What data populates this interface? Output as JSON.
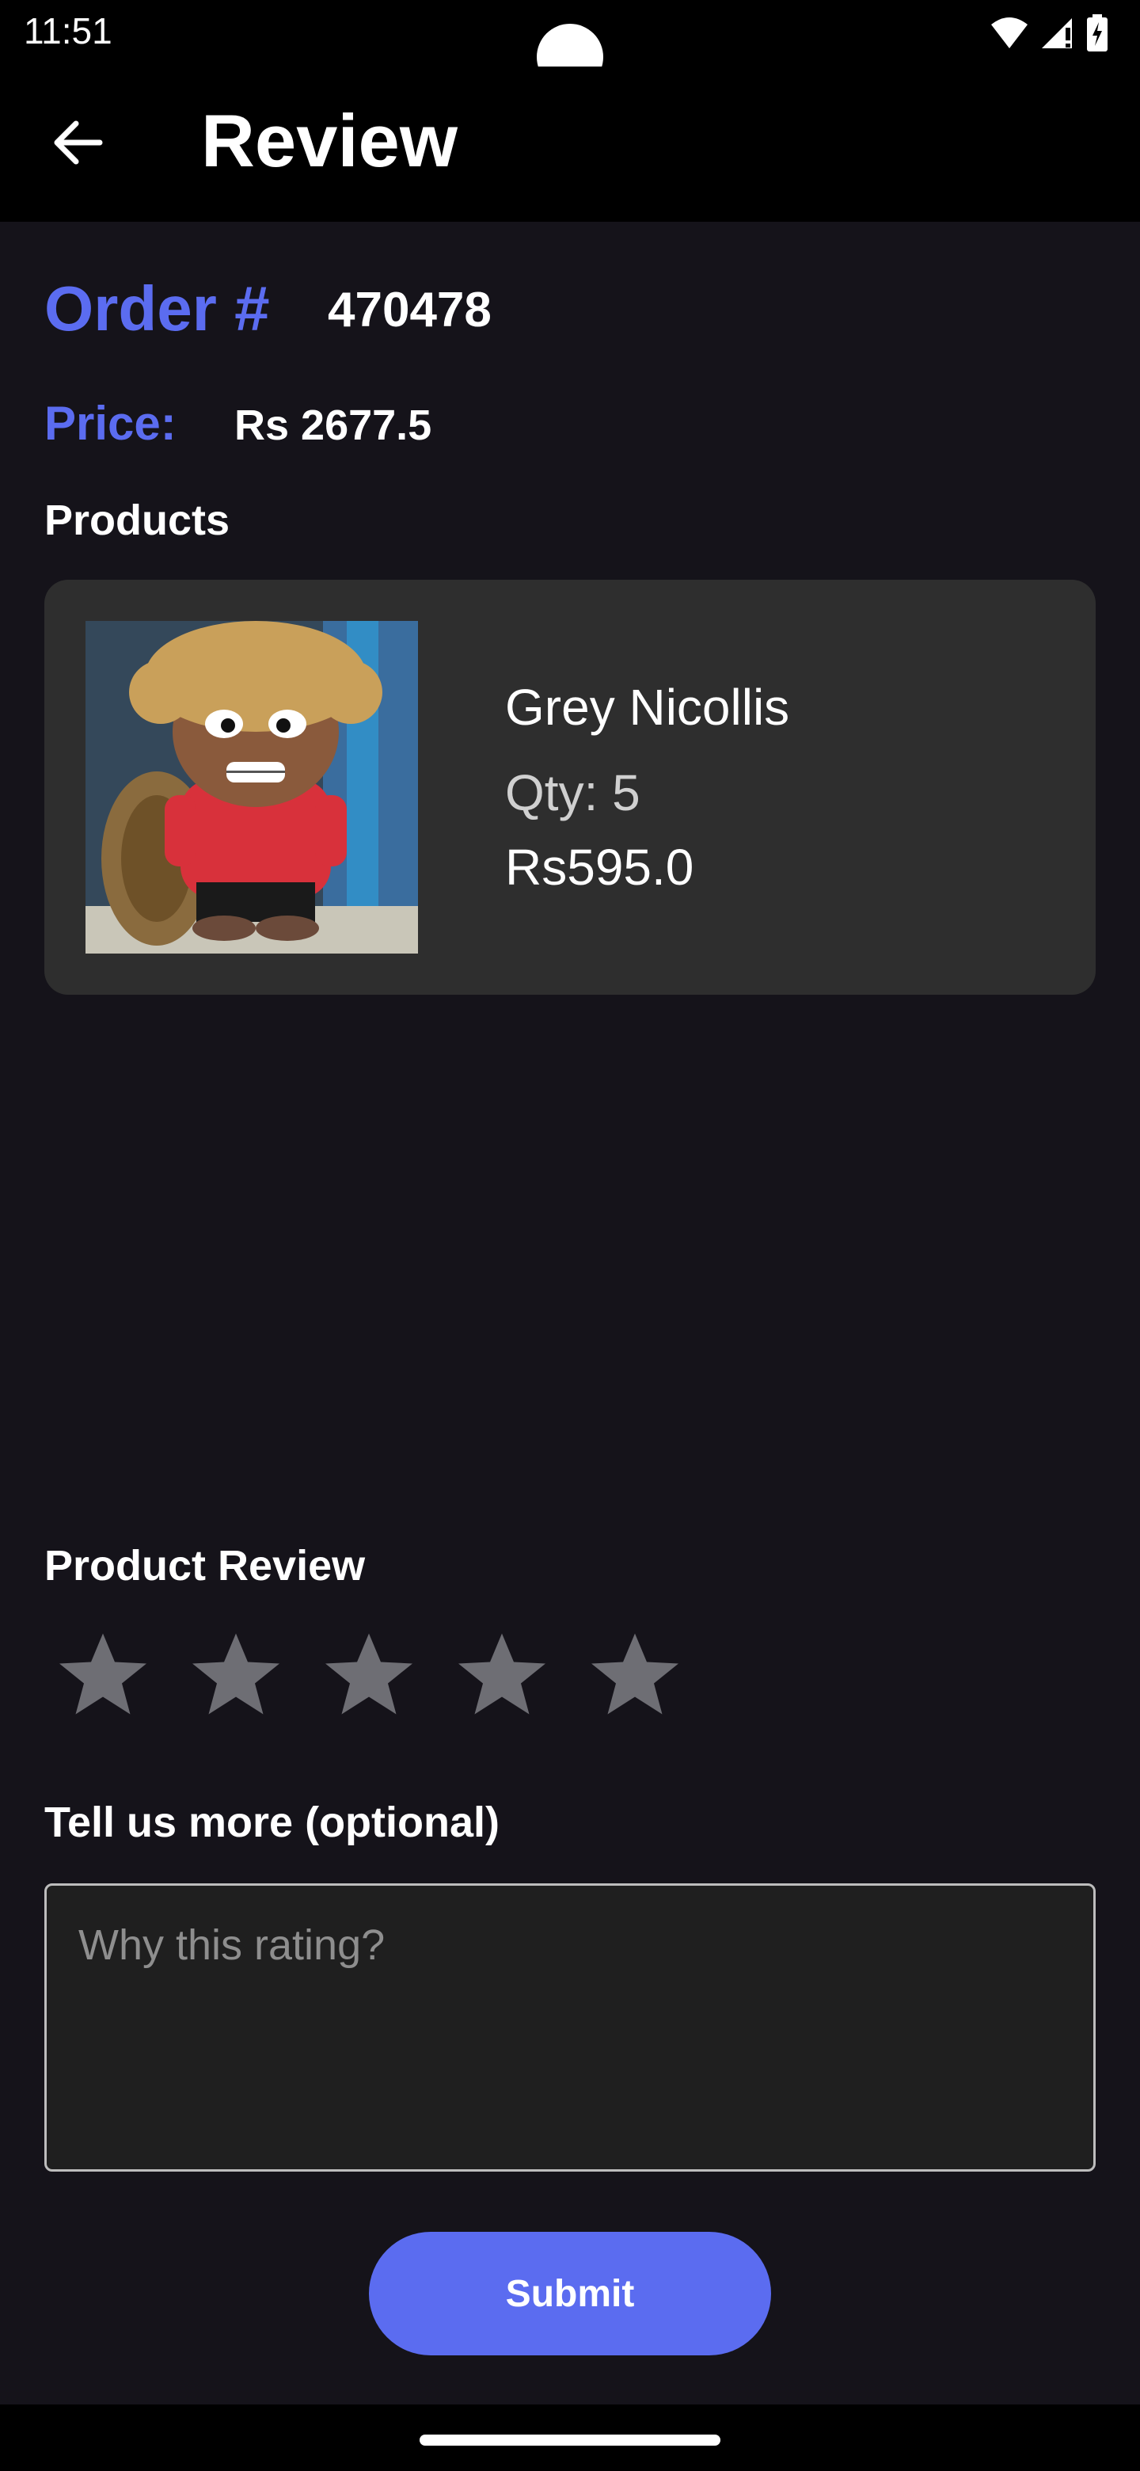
{
  "status_bar": {
    "time": "11:51"
  },
  "app_bar": {
    "title": "Review"
  },
  "order": {
    "label": "Order #",
    "number": "470478",
    "price_label": "Price:",
    "price": "Rs 2677.5"
  },
  "products_label": "Products",
  "product": {
    "name": "Grey Nicollis",
    "qty": "Qty: 5",
    "price": "Rs595.0"
  },
  "review": {
    "label": "Product Review",
    "rating": 0,
    "max_rating": 5,
    "star_color": "#6e6e74",
    "more_label": "Tell us more (optional)",
    "placeholder": "Why this rating?",
    "value": ""
  },
  "submit_label": "Submit",
  "colors": {
    "accent": "#5b6cf0",
    "background": "#15131a",
    "card": "#2e2e2e"
  }
}
